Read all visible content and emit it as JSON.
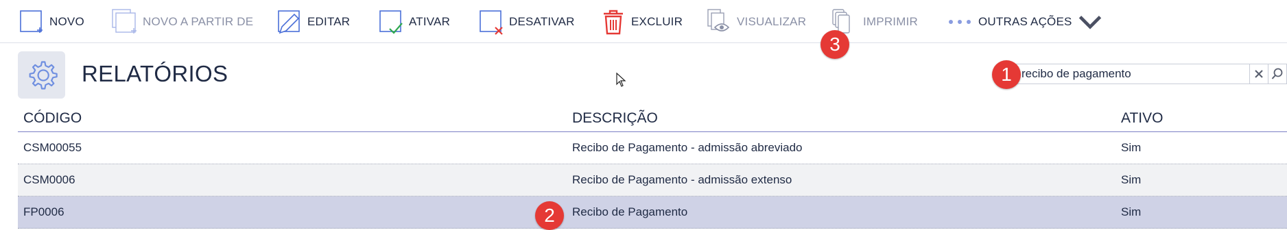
{
  "toolbar": {
    "novo": "NOVO",
    "novo_a_partir_de": "NOVO A PARTIR DE",
    "editar": "EDITAR",
    "ativar": "ATIVAR",
    "desativar": "DESATIVAR",
    "excluir": "EXCLUIR",
    "visualizar": "VISUALIZAR",
    "imprimir": "IMPRIMIR",
    "outras_acoes": "OUTRAS AÇÕES"
  },
  "page": {
    "title": "RELATÓRIOS"
  },
  "search": {
    "value": "recibo de pagamento"
  },
  "table": {
    "headers": [
      "CÓDIGO",
      "DESCRIÇÃO",
      "ATIVO"
    ],
    "rows": [
      [
        "CSM00055",
        "Recibo de Pagamento - admissão abreviado",
        "Sim"
      ],
      [
        "CSM0006",
        "Recibo de Pagamento - admissão extenso",
        "Sim"
      ],
      [
        "FP0006",
        "Recibo de Pagamento",
        "Sim"
      ]
    ]
  },
  "badges": [
    "1",
    "2",
    "3"
  ],
  "colors": {
    "accent": "#4a6fd8",
    "danger": "#e53935",
    "selected_row": "#cfd2e6",
    "badge": "#e53935"
  }
}
